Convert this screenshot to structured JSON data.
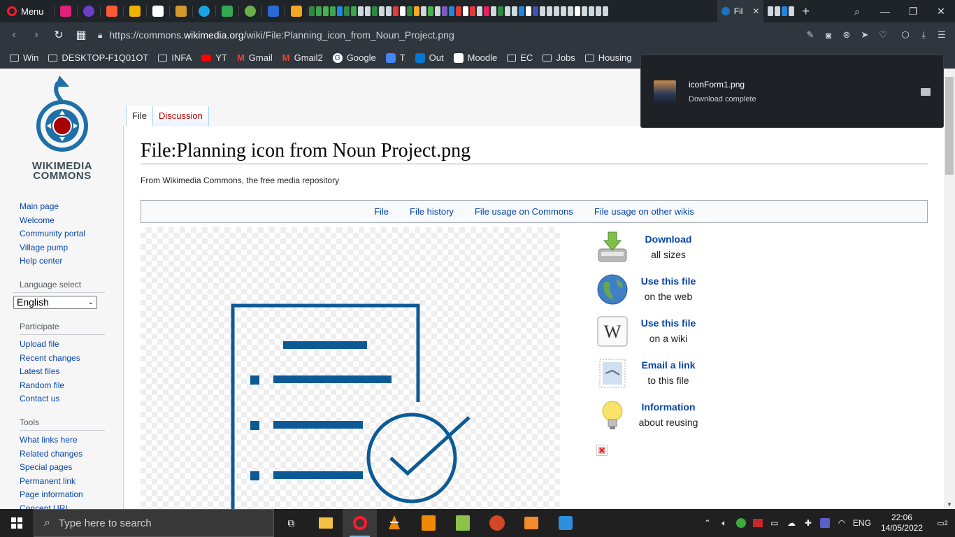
{
  "browser": {
    "menu_label": "Menu",
    "active_tab_title": "Fil",
    "url_prefix": "https://commons.",
    "url_domain": "wikimedia.org",
    "url_path": "/wiki/File:Planning_icon_from_Noun_Project.png",
    "bookmarks": [
      {
        "label": "Win",
        "icon": "folder-icon"
      },
      {
        "label": "DESKTOP-F1Q01OT",
        "icon": "folder-icon"
      },
      {
        "label": "INFA",
        "icon": "folder-icon"
      },
      {
        "label": "YT",
        "icon": "youtube-icon",
        "color": "#ff0000"
      },
      {
        "label": "Gmail",
        "icon": "gmail-icon",
        "color": "#ea4335"
      },
      {
        "label": "Gmail2",
        "icon": "gmail-icon",
        "color": "#ea4335"
      },
      {
        "label": "Google",
        "icon": "google-icon",
        "color": "#4285f4"
      },
      {
        "label": "T",
        "icon": "translate-icon",
        "color": "#4285f4"
      },
      {
        "label": "Out",
        "icon": "outlook-icon",
        "color": "#0078d4"
      },
      {
        "label": "Moodle",
        "icon": "moodle-icon",
        "color": "#ffffff"
      },
      {
        "label": "EC",
        "icon": "folder-icon"
      },
      {
        "label": "Jobs",
        "icon": "folder-icon"
      },
      {
        "label": "Housing",
        "icon": "folder-icon"
      }
    ]
  },
  "download": {
    "filename": "iconForm1.png",
    "status": "Download complete"
  },
  "wiki": {
    "logo_line1": "WIKIMEDIA",
    "logo_line2": "COMMONS",
    "nav": [
      "Main page",
      "Welcome",
      "Community portal",
      "Village pump",
      "Help center"
    ],
    "language_heading": "Language select",
    "language_value": "English",
    "participate_heading": "Participate",
    "participate": [
      "Upload file",
      "Recent changes",
      "Latest files",
      "Random file",
      "Contact us"
    ],
    "tools_heading": "Tools",
    "tools": [
      "What links here",
      "Related changes",
      "Special pages",
      "Permanent link",
      "Page information",
      "Concept URI"
    ],
    "tab_file": "File",
    "tab_discussion": "Discussion",
    "title": "File:Planning icon from Noun Project.png",
    "tagline": "From Wikimedia Commons, the free media repository",
    "filetoc": [
      "File",
      "File history",
      "File usage on Commons",
      "File usage on other wikis"
    ],
    "actions": [
      {
        "title": "Download",
        "sub": "all sizes",
        "icon": "download-icon"
      },
      {
        "title": "Use this file",
        "sub": "on the web",
        "icon": "globe-icon"
      },
      {
        "title": "Use this file",
        "sub": "on a wiki",
        "icon": "wikipedia-icon"
      },
      {
        "title": "Email a link",
        "sub": "to this file",
        "icon": "email-stamp-icon"
      },
      {
        "title": "Information",
        "sub": "about reusing",
        "icon": "lightbulb-icon"
      }
    ],
    "icon_color": "#0c5a95"
  },
  "taskbar": {
    "search_placeholder": "Type here to search",
    "language": "ENG",
    "time": "22:06",
    "date": "14/05/2022",
    "notification_count": "2"
  }
}
